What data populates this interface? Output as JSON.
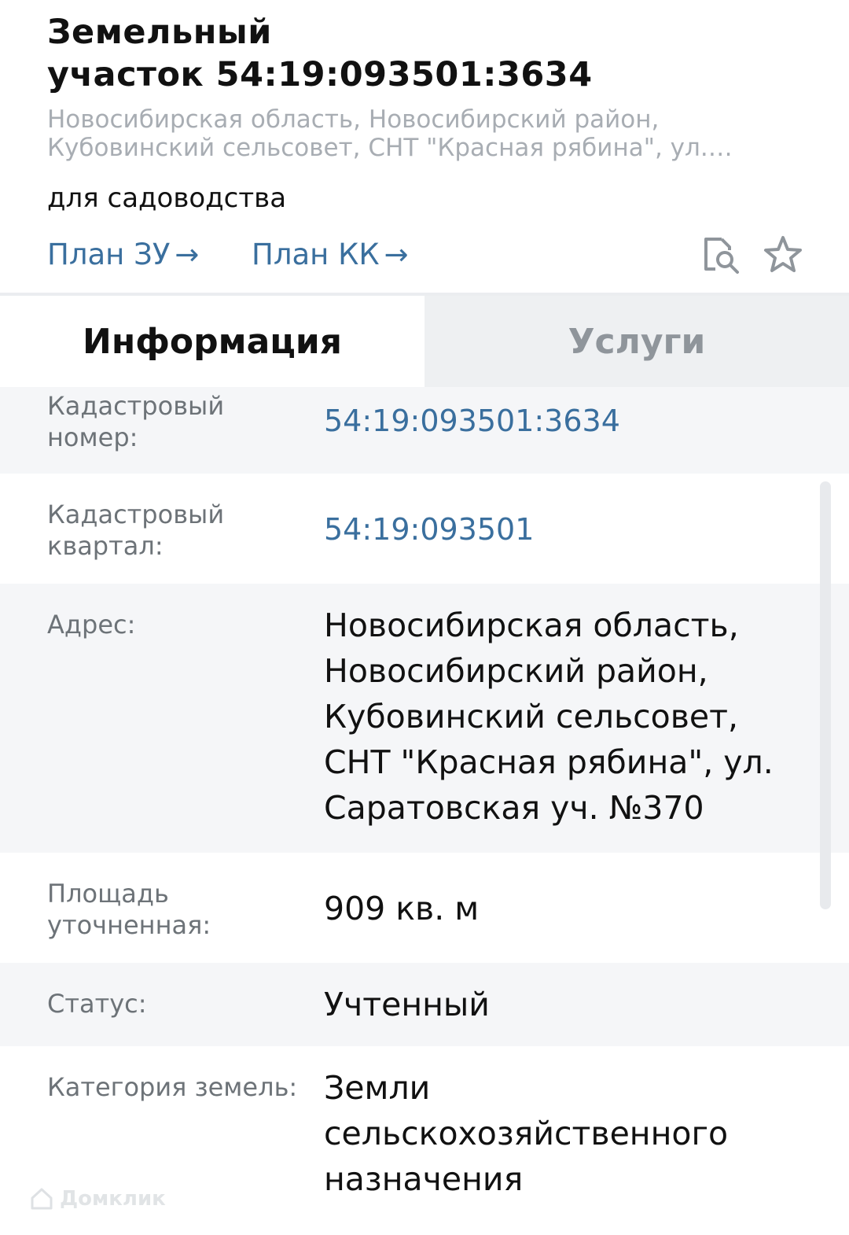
{
  "header": {
    "title": "Земельный\nучасток 54:19:093501:3634",
    "address_short": "Новосибирская область, Новосибирский район,\nКубовинский сельсовет, СНТ \"Красная рябина\", ул.…",
    "purpose": "для садоводства",
    "links": [
      {
        "label": "План ЗУ"
      },
      {
        "label": "План КК"
      }
    ],
    "arrow": "→",
    "icons": [
      "document-search-icon",
      "star-icon"
    ]
  },
  "tabs": [
    {
      "label": "Информация",
      "active": true
    },
    {
      "label": "Услуги",
      "active": false
    }
  ],
  "info": {
    "cadastral_number": {
      "label": "Кадастровый\nномер:",
      "value": "54:19:093501:3634"
    },
    "cadastral_block": {
      "label": "Кадастровый\nквартал:",
      "value": "54:19:093501"
    },
    "address": {
      "label": "Адрес:",
      "value": "Новосибирская область,\nНовосибирский район,\nКубовинский сельсовет,\nСНТ \"Красная рябина\", ул.\nСаратовская уч. №370"
    },
    "area": {
      "label": "Площадь\nуточненная:",
      "value": "909 кв. м"
    },
    "status": {
      "label": "Статус:",
      "value": "Учтенный"
    },
    "land_category": {
      "label": "Категория земель:",
      "value": "Земли\nсельскохозяйственного\nназначения"
    }
  },
  "watermark": "Домклик",
  "colors": {
    "link": "#3a6f9e",
    "muted": "#a8adb3",
    "label": "#6d7378",
    "row_shade": "#f5f6f8",
    "tab_inactive_bg": "#eef0f2"
  }
}
